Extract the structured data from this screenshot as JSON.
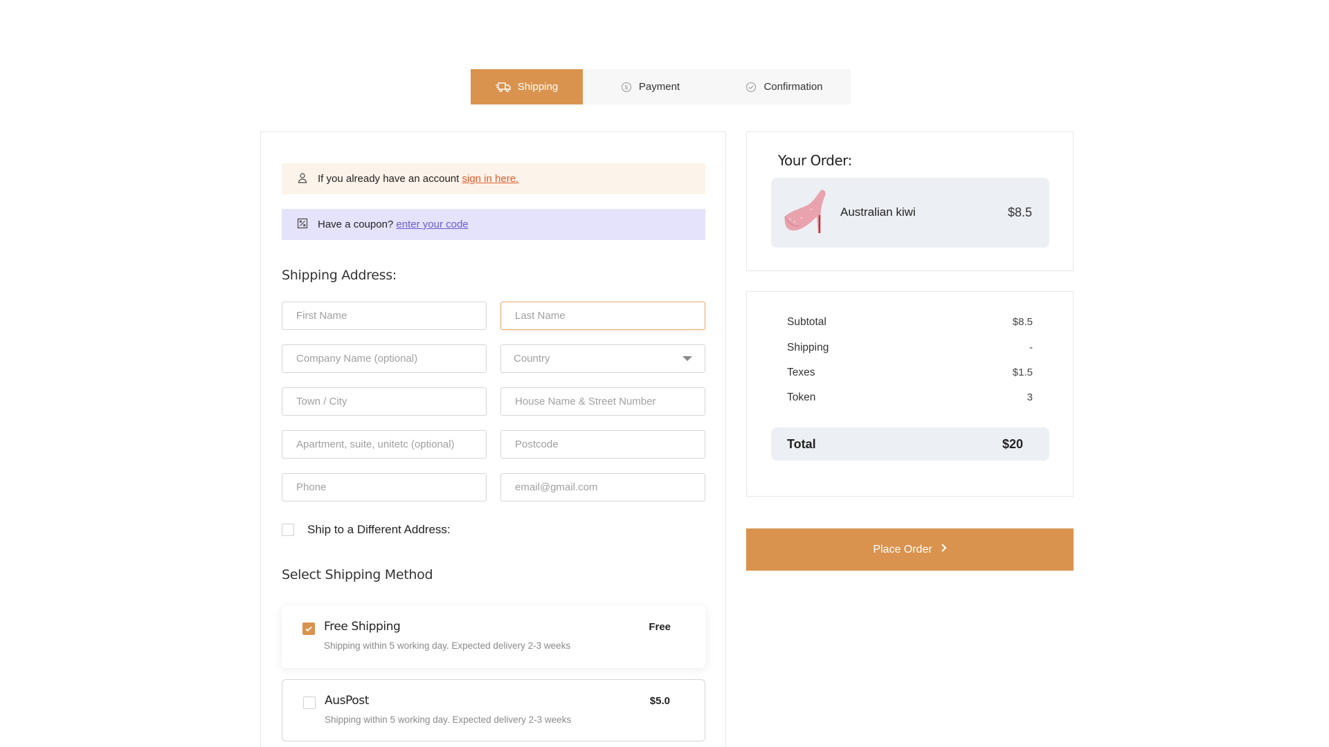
{
  "steps": [
    {
      "label": "Shipping",
      "icon": "truck-icon",
      "active": true
    },
    {
      "label": "Payment",
      "icon": "dollar-circle-icon",
      "active": false
    },
    {
      "label": "Confirmation",
      "icon": "check-circle-icon",
      "active": false
    }
  ],
  "notices": {
    "account_text": "If you already have an account",
    "account_link": "sign in here.",
    "coupon_text": "Have a coupon?",
    "coupon_link": "enter your code"
  },
  "shipping_address": {
    "title": "Shipping Address:",
    "first_name_placeholder": "First Name",
    "last_name_placeholder": "Last Name",
    "company_placeholder": "Company Name (optional)",
    "country_placeholder": "Country",
    "town_placeholder": "Town / City",
    "house_placeholder": "House Name & Street Number",
    "apartment_placeholder": "Apartment, suite, unitetc (optional)",
    "postcode_placeholder": "Postcode",
    "phone_placeholder": "Phone",
    "email_placeholder": "email@gmail.com",
    "ship_different_label": "Ship to a Different Address:"
  },
  "shipping_method": {
    "title": "Select Shipping Method",
    "options": [
      {
        "name": "Free Shipping",
        "desc": "Shipping within  5 working day. Expected delivery 2-3 weeks",
        "price": "Free",
        "checked": true
      },
      {
        "name": "AusPost",
        "desc": "Shipping within  5 working day. Expected delivery 2-3 weeks",
        "price": "$5.0",
        "checked": false
      }
    ]
  },
  "order": {
    "title": "Your Order:",
    "item_name": "Australian kiwi",
    "item_price": "$8.5"
  },
  "totals": {
    "subtotal_label": "Subtotal",
    "subtotal_value": "$8.5",
    "shipping_label": "Shipping",
    "shipping_value": "-",
    "taxes_label": "Texes",
    "taxes_value": "$1.5",
    "token_label": "Token",
    "token_value": "3",
    "total_label": "Total",
    "total_value": "$20"
  },
  "place_order_label": "Place Order",
  "colors": {
    "accent": "#d9934e",
    "coupon_bg": "#e5e2fb",
    "account_bg": "#fcf3ea"
  }
}
